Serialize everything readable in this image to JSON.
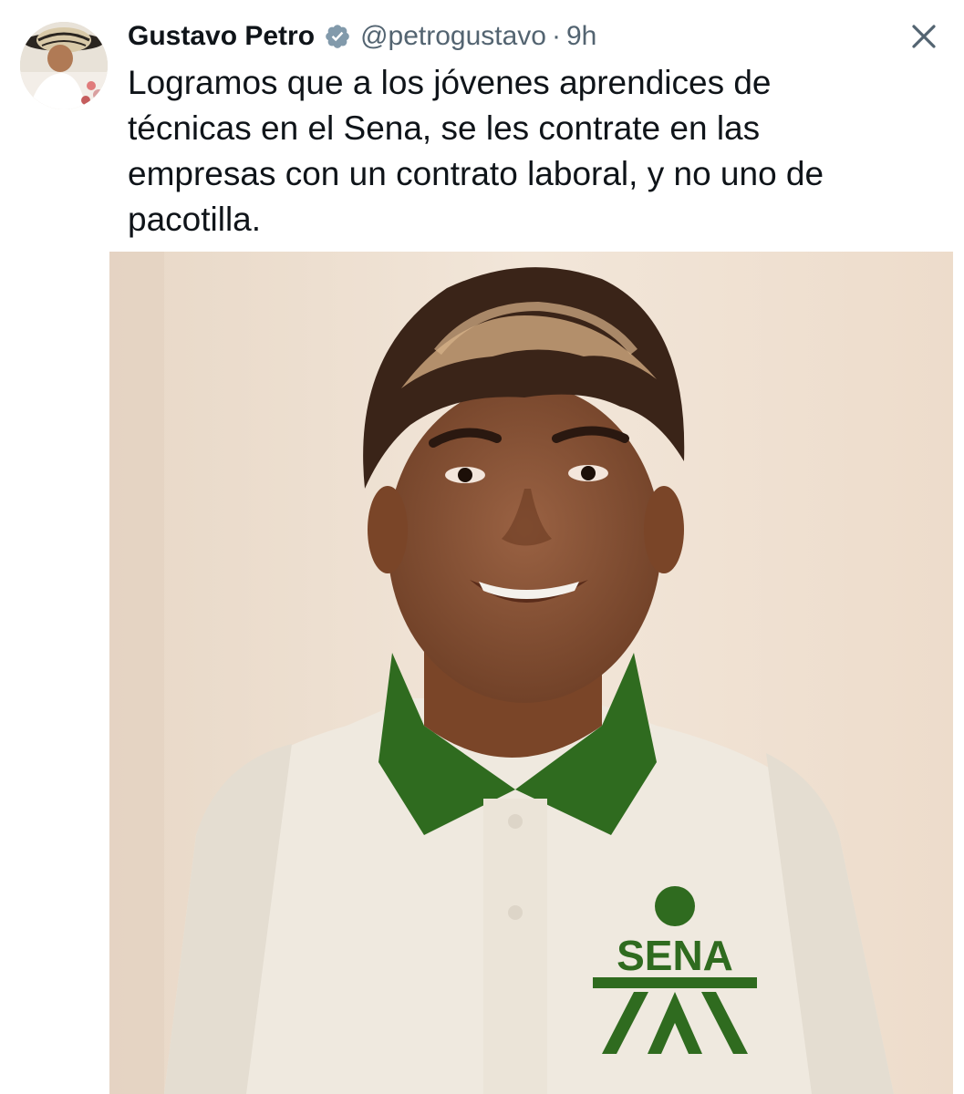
{
  "tweet": {
    "author_name": "Gustavo Petro",
    "handle": "@petrogustavo",
    "separator": "·",
    "time": "9h",
    "text_lines": [
      "Logramos que a los jóvenes aprendices de",
      "técnicas en el Sena, se les contrate en las",
      "empresas con un contrato laboral, y no uno de",
      "pacotilla."
    ]
  },
  "media": {
    "shirt_logo_text": "SENA",
    "colors": {
      "background": "#efe2d4",
      "collar_green": "#2f6b1f",
      "shirt": "#efe9df",
      "skin": "#8a5436"
    }
  },
  "icons": {
    "verified": "verified-badge-icon",
    "close": "close-icon"
  },
  "colors": {
    "text_primary": "#0f1419",
    "text_secondary": "#536471",
    "verified_gray": "#829aab"
  }
}
